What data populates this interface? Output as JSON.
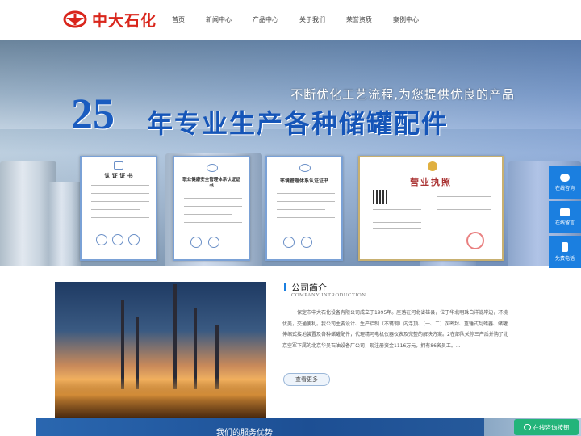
{
  "header": {
    "logo_text": "中大石化",
    "nav": [
      "首页",
      "新闻中心",
      "产品中心",
      "关于我们",
      "荣誉资质",
      "案例中心"
    ]
  },
  "banner": {
    "slogan": "不断优化工艺流程,为您提供优良的产品",
    "headline_number": "25",
    "headline_text": "年专业生产各种储罐配件",
    "certificates": [
      {
        "title": "认 证 证 书"
      },
      {
        "title": "职业健康安全管理体系认证证书"
      },
      {
        "title": "环境管理体系认证证书"
      },
      {
        "title": "营业执照"
      }
    ]
  },
  "side_bar": {
    "items": [
      {
        "label": "在线咨询",
        "icon": "chat-bubble-icon"
      },
      {
        "label": "在线留言",
        "icon": "message-icon"
      },
      {
        "label": "免费电话",
        "icon": "phone-icon"
      }
    ]
  },
  "intro": {
    "title": "公司简介",
    "subtitle": "COMPANY INTRODUCTION",
    "body": "保定市中大石化设备有限公司成立于1995年。座落在河北省雄县，位于华北明珠白洋淀岸边，环境优美，交通便利。我公司主要设计、生产铝制（不锈钢）内浮顶、（一、二）次密封、重锤式刮蜡器、储罐伸缩式接地装置及各种储罐配件，代理精河电机仪器仪表及完整的解决方案。2在部队关停三产后并购了北京空军下属的北京华吴石油设备厂公司，现注册资金1116万元，拥有86名员工。...",
    "more_label": "查看更多"
  },
  "service": {
    "title": "我们的服务优势",
    "chat_label": "在线咨询按钮"
  },
  "colors": {
    "brand_red": "#d9261c",
    "accent_blue": "#1b7fe0",
    "chat_green": "#23b47a"
  }
}
